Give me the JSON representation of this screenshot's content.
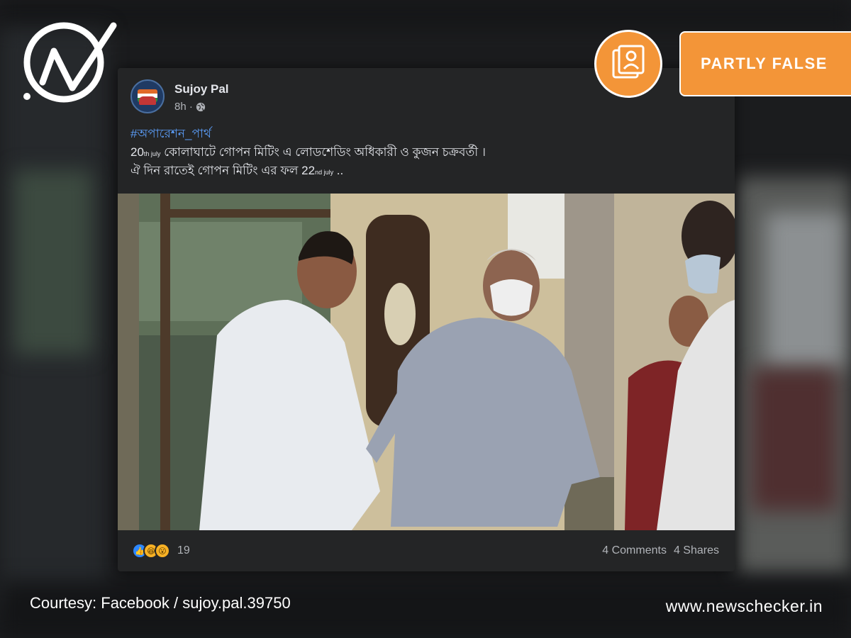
{
  "post": {
    "author": "Sujoy Pal",
    "time": "8h ·",
    "hashtag": "#অপারেশন_পার্থ",
    "line1": {
      "num1": "20",
      "sup1": "th july",
      "text1": " কোলাঘাটে গোপন মিটিং এ লোডশেডিং অধিকারী ও কুজন চক্রবর্তী ।"
    },
    "line2": {
      "text1": "ঐ দিন রাতেই গোপন মিটিং এর ফল 22",
      "sup1": "nd july",
      "text2": " .."
    },
    "reactions_count": "19",
    "comments": "4 Comments",
    "shares": "4 Shares"
  },
  "badge": {
    "label": "PARTLY FALSE",
    "color": "#f39538"
  },
  "footer": {
    "courtesy": "Courtesy: Facebook / sujoy.pal.39750",
    "site": "www.newschecker.in"
  },
  "icons": [
    "newschecker-logo-icon",
    "globe-icon",
    "more-options-icon",
    "like-reaction-icon",
    "haha-reaction-icon",
    "wow-reaction-icon",
    "fact-check-icon"
  ]
}
